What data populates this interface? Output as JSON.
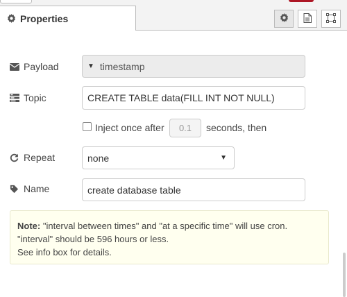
{
  "tabs": {
    "properties_label": "Properties"
  },
  "form": {
    "payload": {
      "label": "Payload",
      "value": "timestamp"
    },
    "topic": {
      "label": "Topic",
      "value": "CREATE TABLE data(FILL INT NOT NULL)"
    },
    "inject": {
      "label": "Inject once after",
      "delay_placeholder": "0.1",
      "suffix": "seconds, then"
    },
    "repeat": {
      "label": "Repeat",
      "value": "none"
    },
    "name": {
      "label": "Name",
      "value": "create database table"
    }
  },
  "note": {
    "title": "Note:",
    "line1": "\"interval between times\" and \"at a specific time\" will use cron.",
    "line2": "\"interval\" should be 596 hours or less.",
    "line3": "See info box for details."
  },
  "icons": {
    "tab": "gear-icon",
    "toolbar": [
      "gear-icon",
      "document-icon",
      "frame-icon"
    ],
    "payload": "envelope-icon",
    "topic": "tasks-icon",
    "repeat": "repeat-icon",
    "name": "tag-icon"
  }
}
